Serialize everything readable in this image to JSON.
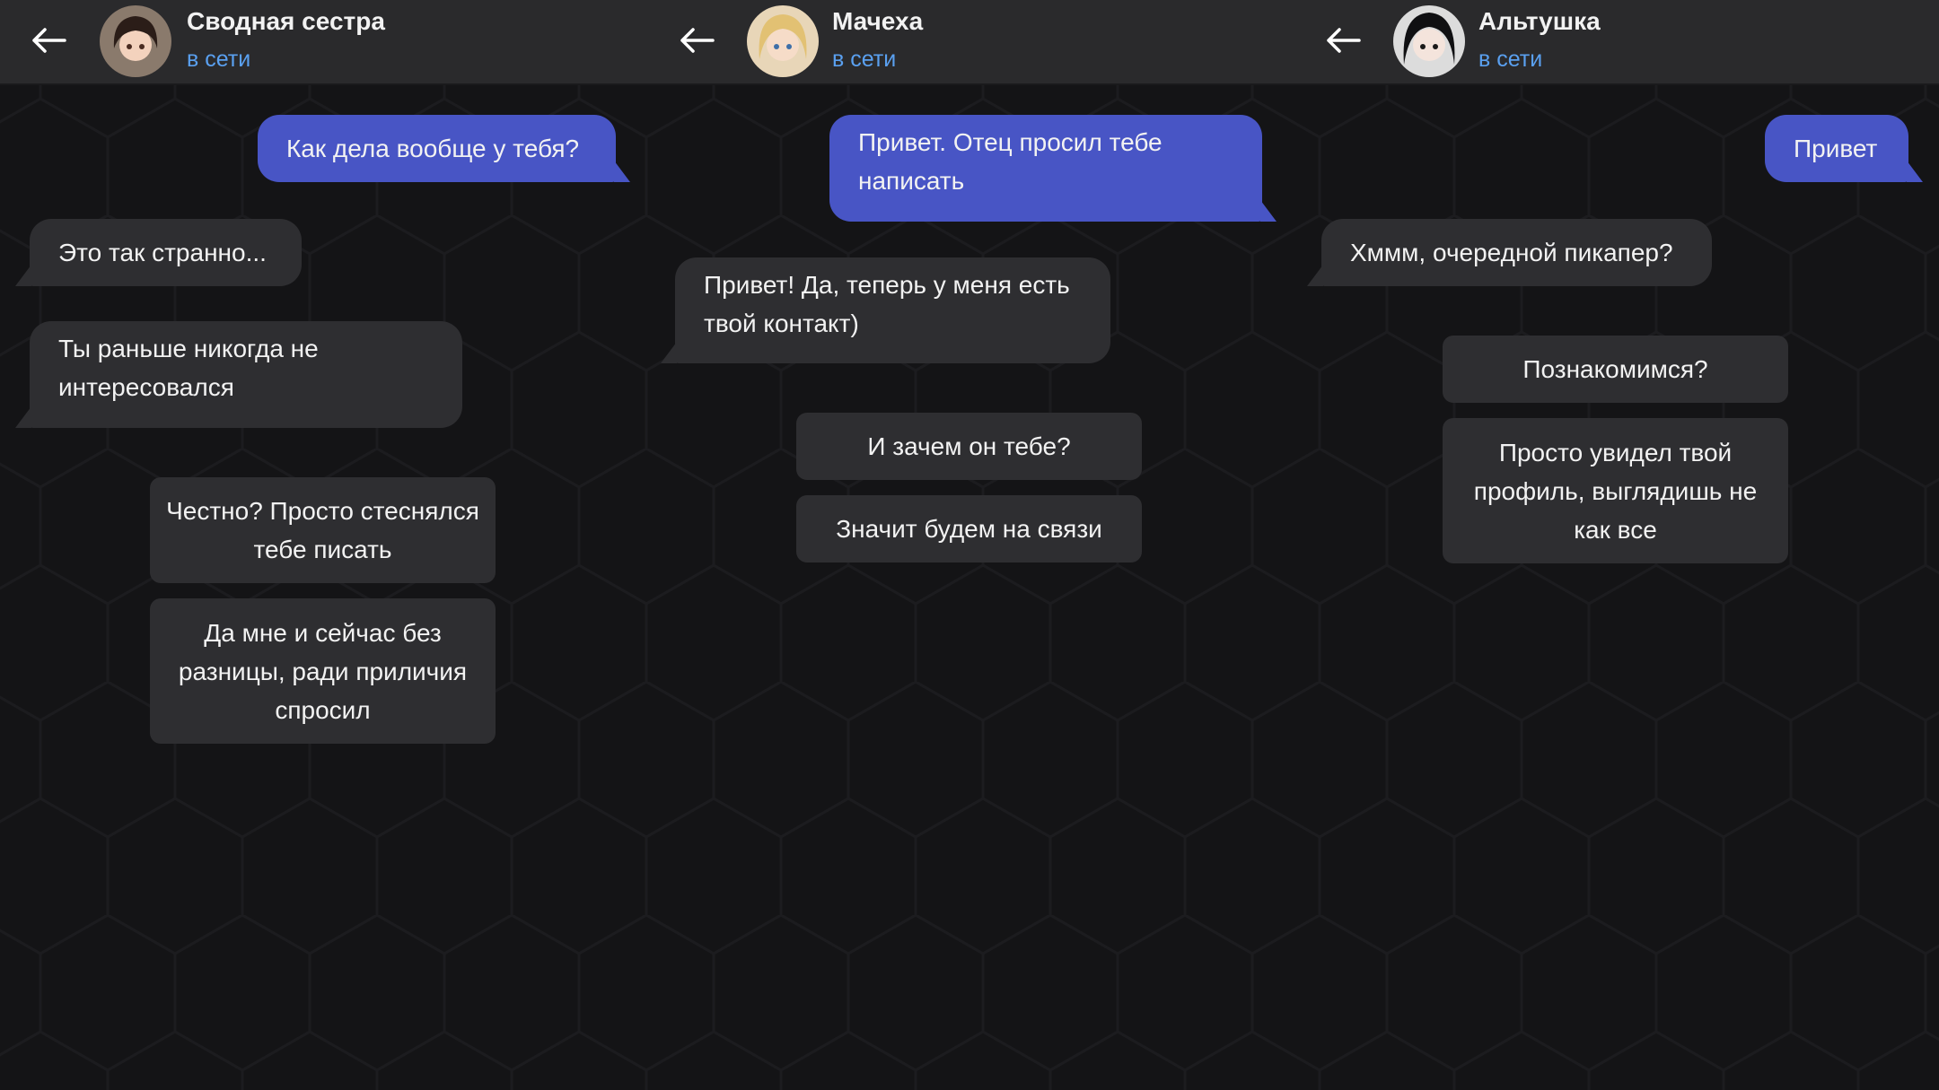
{
  "chats": [
    {
      "name": "Сводная сестра",
      "status": "в сети",
      "avatar": "brunette-girl-avatar",
      "messages": [
        {
          "dir": "out",
          "text": "Как дела вообще у тебя?"
        },
        {
          "dir": "in",
          "text": "Это так странно..."
        },
        {
          "dir": "in",
          "text": "Ты раньше никогда не интересовался"
        }
      ],
      "choices": [
        "Честно? Просто стеснялся тебе писать",
        "Да мне и сейчас без разницы, ради приличия спросил"
      ]
    },
    {
      "name": "Мачеха",
      "status": "в сети",
      "avatar": "blonde-woman-avatar",
      "messages": [
        {
          "dir": "out",
          "text": "Привет. Отец просил тебе написать"
        },
        {
          "dir": "in",
          "text": "Привет! Да, теперь у меня есть твой контакт)"
        }
      ],
      "choices": [
        "И зачем он тебе?",
        "Значит будем на связи"
      ]
    },
    {
      "name": "Альтушка",
      "status": "в сети",
      "avatar": "black-hair-girl-avatar",
      "messages": [
        {
          "dir": "out",
          "text": "Привет"
        },
        {
          "dir": "in",
          "text": "Хммм, очередной пикапер?"
        }
      ],
      "choices": [
        "Познакомимся?",
        "Просто увидел твой профиль, выглядишь не как все"
      ]
    }
  ],
  "colors": {
    "outgoing": "#4855c5",
    "incoming": "#2e2e31",
    "status": "#5aa0f0",
    "header": "#2a2a2c"
  }
}
